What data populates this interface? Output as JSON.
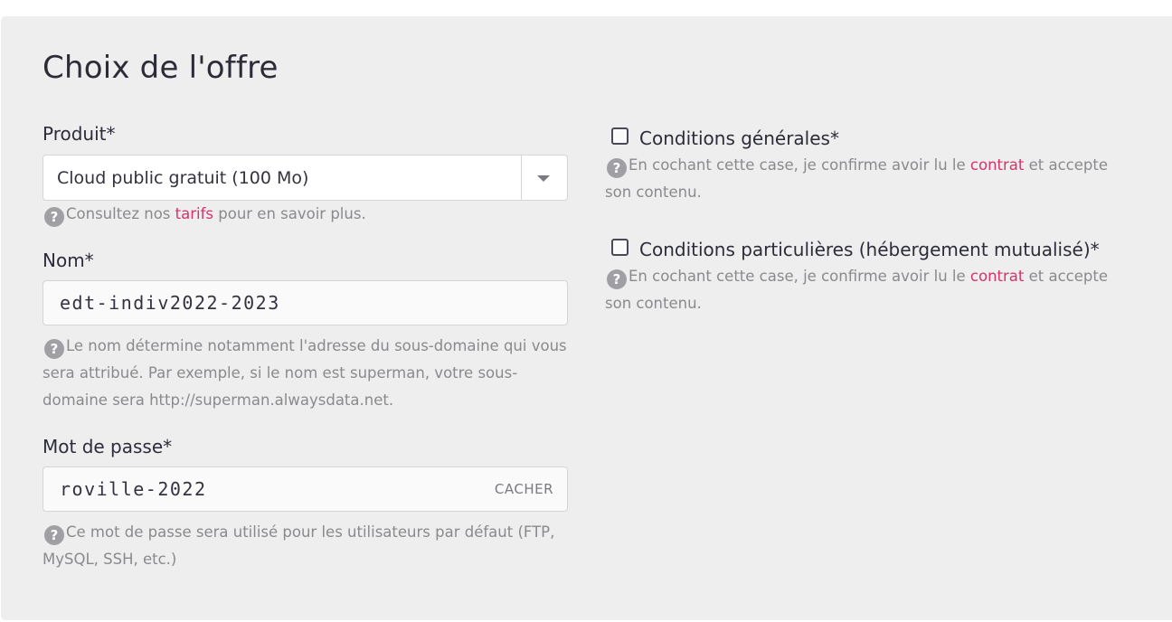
{
  "title": "Choix de l'offre",
  "product": {
    "label": "Produit*",
    "selected": "Cloud public gratuit (100 Mo)",
    "help_prefix": "Consultez nos ",
    "help_link": "tarifs",
    "help_suffix": " pour en savoir plus."
  },
  "name": {
    "label": "Nom*",
    "value": "edt-indiv2022-2023",
    "help": "Le nom détermine notamment l'adresse du sous-domaine qui vous sera attribué. Par exemple, si le nom est superman, votre sous-domaine sera http://superman.alwaysdata.net."
  },
  "password": {
    "label": "Mot de passe*",
    "value": "roville-2022",
    "toggle_label": "CACHER",
    "help": "Ce mot de passe sera utilisé pour les utilisateurs par défaut (FTP, MySQL, SSH, etc.)"
  },
  "terms_general": {
    "label": "Conditions générales*",
    "checked": false,
    "help_prefix": "En cochant cette case, je confirme avoir lu le ",
    "help_link": "contrat",
    "help_suffix": " et accepte son contenu."
  },
  "terms_specific": {
    "label": "Conditions particulières (hébergement mutualisé)*",
    "checked": false,
    "help_prefix": "En cochant cette case, je confirme avoir lu le ",
    "help_link": "contrat",
    "help_suffix": " et accepte son contenu."
  },
  "colors": {
    "panel_bg": "#eeeeee",
    "link": "#d6336c",
    "help_text": "#8a8a8e"
  }
}
